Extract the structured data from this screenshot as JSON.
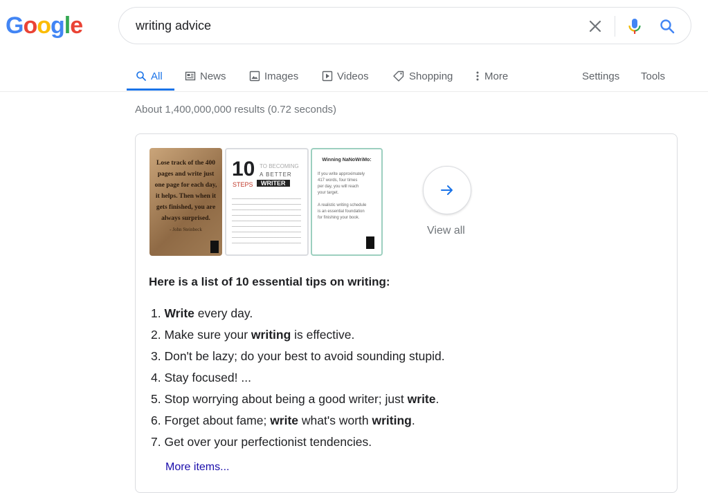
{
  "logo": {
    "letters": [
      "G",
      "o",
      "o",
      "g",
      "l",
      "e"
    ],
    "colors": [
      "#4285F4",
      "#EA4335",
      "#FBBC05",
      "#4285F4",
      "#34A853",
      "#EA4335"
    ]
  },
  "search": {
    "query": "writing advice"
  },
  "tabs": [
    {
      "label": "All",
      "icon": "search-icon",
      "active": true
    },
    {
      "label": "News",
      "icon": "news-icon"
    },
    {
      "label": "Images",
      "icon": "image-icon"
    },
    {
      "label": "Videos",
      "icon": "play-icon"
    },
    {
      "label": "Shopping",
      "icon": "tag-icon"
    },
    {
      "label": "More",
      "icon": "more-vert-icon"
    }
  ],
  "tools": {
    "settings": "Settings",
    "tools": "Tools"
  },
  "stats": "About 1,400,000,000 results (0.72 seconds)",
  "thumbnails": {
    "t1": {
      "lines": [
        "Lose track of the 400",
        "pages and write just",
        "one page for each day,",
        "it helps. Then when it",
        "gets finished, you are",
        "always surprised."
      ],
      "author": "- John Steinbeck"
    },
    "t2": {
      "big": "10",
      "steps": "STEPS",
      "to": "TO BECOMING",
      "a": "A BETTER",
      "writer": "WRITER"
    },
    "t3": {
      "title": "Winning NaNoWriMo:",
      "lines": [
        "If you write approximately",
        "417 words, four times",
        "per day, you will reach",
        "your target.",
        "",
        "A realistic writing schedule",
        "is an essential foundation",
        "for finishing your book."
      ]
    }
  },
  "view_all": "View all",
  "snippet": {
    "heading": "Here is a list of 10 essential tips on writing:",
    "items": [
      [
        {
          "t": "1. "
        },
        {
          "t": "Write",
          "b": true
        },
        {
          "t": " every day."
        }
      ],
      [
        {
          "t": "2. Make sure your "
        },
        {
          "t": "writing",
          "b": true
        },
        {
          "t": " is effective."
        }
      ],
      [
        {
          "t": "3. Don't be lazy; do your best to avoid sounding stupid."
        }
      ],
      [
        {
          "t": "4. Stay focused! ..."
        }
      ],
      [
        {
          "t": "5. Stop worrying about being a good writer; just "
        },
        {
          "t": "write",
          "b": true
        },
        {
          "t": "."
        }
      ],
      [
        {
          "t": "6. Forget about fame; "
        },
        {
          "t": "write",
          "b": true
        },
        {
          "t": " what's worth "
        },
        {
          "t": "writing",
          "b": true
        },
        {
          "t": "."
        }
      ],
      [
        {
          "t": "7. Get over your perfectionist tendencies."
        }
      ]
    ],
    "more": "More items..."
  }
}
